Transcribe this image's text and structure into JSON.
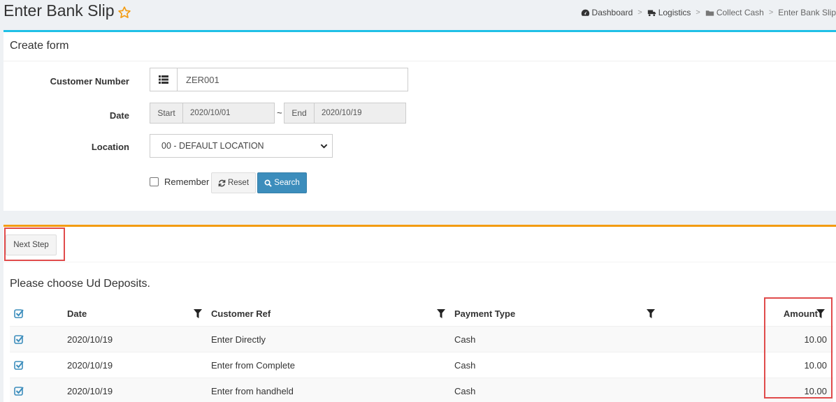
{
  "header": {
    "title": "Enter Bank Slip",
    "breadcrumb": [
      {
        "label": "Dashboard",
        "icon": "dashboard-icon"
      },
      {
        "label": "Logistics",
        "icon": "truck-icon"
      },
      {
        "label": "Collect Cash",
        "icon": "folder-icon"
      },
      {
        "label": "Enter Bank Slip",
        "icon": null
      }
    ],
    "breadcrumb_separator": ">"
  },
  "create_form": {
    "title": "Create form",
    "customer_number": {
      "label": "Customer Number",
      "value": "ZER001",
      "icon": "list-icon"
    },
    "date": {
      "label": "Date",
      "start_label": "Start",
      "start_value": "2020/10/01",
      "separator": "~",
      "end_label": "End",
      "end_value": "2020/10/19"
    },
    "location": {
      "label": "Location",
      "selected": "00 - DEFAULT LOCATION"
    },
    "remember_label": "Remember",
    "reset_label": "Reset",
    "search_label": "Search"
  },
  "list": {
    "next_step_label": "Next Step",
    "caption": "Please choose Ud Deposits.",
    "columns": [
      "Date",
      "Customer Ref",
      "Payment Type",
      "Amount"
    ],
    "rows": [
      {
        "date": "2020/10/19",
        "customer_ref": "Enter Directly",
        "payment_type": "Cash",
        "amount": "10.00"
      },
      {
        "date": "2020/10/19",
        "customer_ref": "Enter from Complete",
        "payment_type": "Cash",
        "amount": "10.00"
      },
      {
        "date": "2020/10/19",
        "customer_ref": "Enter from handheld",
        "payment_type": "Cash",
        "amount": "10.00"
      }
    ]
  },
  "colors": {
    "info_accent": "#1fc0e6",
    "warning_accent": "#f39c12",
    "primary": "#3c8dbc",
    "highlight": "#e04b4b",
    "star": "#f39c12"
  }
}
